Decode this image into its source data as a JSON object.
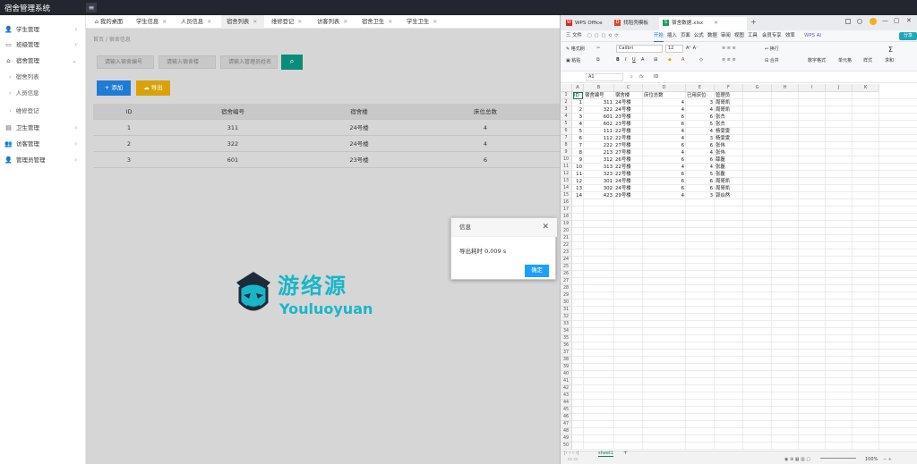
{
  "app": {
    "title": "宿舍管理系统",
    "menu_toggle": "≡"
  },
  "sidebar": {
    "items": [
      {
        "label": "学生管理",
        "icon": "user-icon",
        "glyph": "👤"
      },
      {
        "label": "班级管理",
        "icon": "folder-icon",
        "glyph": "▭"
      },
      {
        "label": "宿舍管理",
        "icon": "home-icon",
        "glyph": "⌂"
      },
      {
        "label": "卫生管理",
        "icon": "clipboard-icon",
        "glyph": "▤"
      },
      {
        "label": "访客管理",
        "icon": "users-icon",
        "glyph": "👥"
      },
      {
        "label": "管理员管理",
        "icon": "admin-icon",
        "glyph": "👤"
      }
    ],
    "subitems": [
      "宿舍列表",
      "人员信息",
      "维修登记"
    ]
  },
  "tabs": [
    {
      "label": "我的桌面",
      "icon": "⌂"
    },
    {
      "label": "学生信息"
    },
    {
      "label": "人员信息"
    },
    {
      "label": "宿舍列表"
    },
    {
      "label": "维修登记"
    },
    {
      "label": "访客列表"
    },
    {
      "label": "宿舍卫生"
    },
    {
      "label": "学生卫生"
    }
  ],
  "breadcrumb": "首页 / 宿舍信息",
  "search": {
    "placeholder_1": "请输入宿舍编号",
    "placeholder_2": "请输入宿舍楼",
    "placeholder_3": "请输入管理员姓名",
    "button_icon": "⌕"
  },
  "buttons": {
    "add": "+ 添加",
    "export": "导出"
  },
  "table": {
    "headers": [
      "ID",
      "宿舍编号",
      "宿舍楼",
      "床位总数"
    ],
    "rows": [
      [
        "1",
        "311",
        "24号楼",
        "4"
      ],
      [
        "2",
        "322",
        "24号楼",
        "4"
      ],
      [
        "3",
        "601",
        "23号楼",
        "6"
      ]
    ]
  },
  "dialog": {
    "title": "信息",
    "close": "✕",
    "message": "导出耗时 0.009 s",
    "ok": "确定"
  },
  "watermark": {
    "cn": "游络源",
    "en": "Youluoyuan"
  },
  "wps": {
    "tabs": [
      "WPS Office",
      "找稻壳模板",
      "宿舍数据.xlsx"
    ],
    "window_controls": [
      "—",
      "▢",
      "✕"
    ],
    "menu": [
      "三 文件",
      "开始",
      "插入",
      "页面",
      "公式",
      "数据",
      "审阅",
      "视图",
      "工具",
      "会员专享",
      "效率",
      "WPS AI"
    ],
    "ribbon": {
      "format_painter": "格式刷",
      "paste": "粘贴",
      "font": "Calibri",
      "size": "12",
      "wrap": "换行",
      "merge": "合并",
      "number_format": "数字格式",
      "cell_style": "单元格",
      "style": "样式",
      "sum": "求和",
      "share": "分享"
    },
    "name_box": "A1",
    "formula": "ID",
    "columns": [
      "A",
      "B",
      "C",
      "D",
      "E",
      "F",
      "G",
      "H",
      "I",
      "J",
      "K"
    ],
    "headers": [
      "ID",
      "宿舍编号",
      "宿舍楼",
      "床位总数",
      "已用床位",
      "管理员"
    ],
    "rows": [
      [
        "1",
        "311",
        "24号楼",
        "4",
        "3",
        "周哥凯"
      ],
      [
        "2",
        "322",
        "24号楼",
        "4",
        "4",
        "周哥凯"
      ],
      [
        "3",
        "601",
        "23号楼",
        "6",
        "6",
        "张杰"
      ],
      [
        "4",
        "602",
        "23号楼",
        "6",
        "5",
        "张杰"
      ],
      [
        "5",
        "111",
        "22号楼",
        "4",
        "4",
        "杨雯雯"
      ],
      [
        "6",
        "112",
        "22号楼",
        "4",
        "3",
        "杨雯雯"
      ],
      [
        "7",
        "222",
        "27号楼",
        "6",
        "6",
        "张伟"
      ],
      [
        "8",
        "213",
        "27号楼",
        "4",
        "4",
        "张伟"
      ],
      [
        "9",
        "312",
        "26号楼",
        "6",
        "6",
        "薛磊"
      ],
      [
        "10",
        "313",
        "22号楼",
        "4",
        "4",
        "张磊"
      ],
      [
        "11",
        "323",
        "22号楼",
        "6",
        "5",
        "张磊"
      ],
      [
        "12",
        "301",
        "24号楼",
        "6",
        "6",
        "周哥凯"
      ],
      [
        "13",
        "302",
        "24号楼",
        "6",
        "6",
        "周哥凯"
      ],
      [
        "14",
        "423",
        "29号楼",
        "4",
        "3",
        "郭焱然"
      ]
    ],
    "sheet": "sheet1",
    "zoom": "100%"
  }
}
